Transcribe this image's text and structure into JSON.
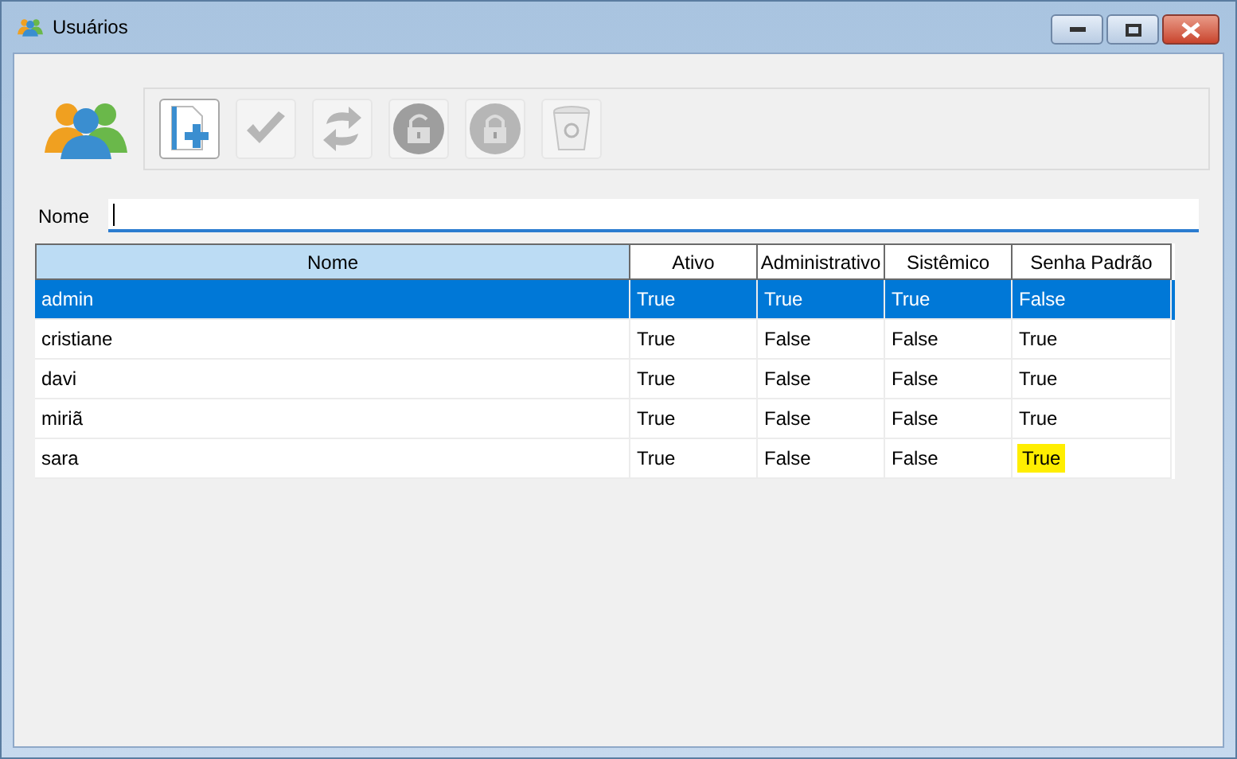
{
  "window": {
    "title": "Usuários"
  },
  "toolbar": [
    {
      "kind": "new",
      "disabled": false
    },
    {
      "kind": "check",
      "disabled": true
    },
    {
      "kind": "refresh",
      "disabled": true
    },
    {
      "kind": "unlock",
      "disabled": true
    },
    {
      "kind": "lock",
      "disabled": true
    },
    {
      "kind": "trash",
      "disabled": true
    }
  ],
  "filter": {
    "label": "Nome"
  },
  "table": {
    "columns": [
      {
        "label": "Nome",
        "selected": true
      },
      {
        "label": "Ativo",
        "selected": false
      },
      {
        "label": "Administrativo",
        "selected": false
      },
      {
        "label": "Sistêmico",
        "selected": false
      },
      {
        "label": "Senha Padrão",
        "selected": false
      }
    ],
    "rows": [
      {
        "selected": true,
        "cells": [
          {
            "text": "admin",
            "highlighted": false
          },
          {
            "text": "True",
            "highlighted": false
          },
          {
            "text": "True",
            "highlighted": false
          },
          {
            "text": "True",
            "highlighted": false
          },
          {
            "text": "False",
            "highlighted": false
          }
        ]
      },
      {
        "selected": false,
        "cells": [
          {
            "text": "cristiane",
            "highlighted": false
          },
          {
            "text": "True",
            "highlighted": false
          },
          {
            "text": "False",
            "highlighted": false
          },
          {
            "text": "False",
            "highlighted": false
          },
          {
            "text": "True",
            "highlighted": false
          }
        ]
      },
      {
        "selected": false,
        "cells": [
          {
            "text": "davi",
            "highlighted": false
          },
          {
            "text": "True",
            "highlighted": false
          },
          {
            "text": "False",
            "highlighted": false
          },
          {
            "text": "False",
            "highlighted": false
          },
          {
            "text": "True",
            "highlighted": false
          }
        ]
      },
      {
        "selected": false,
        "cells": [
          {
            "text": "miriã",
            "highlighted": false
          },
          {
            "text": "True",
            "highlighted": false
          },
          {
            "text": "False",
            "highlighted": false
          },
          {
            "text": "False",
            "highlighted": false
          },
          {
            "text": "True",
            "highlighted": false
          }
        ]
      },
      {
        "selected": false,
        "cells": [
          {
            "text": "sara",
            "highlighted": false
          },
          {
            "text": "True",
            "highlighted": false
          },
          {
            "text": "False",
            "highlighted": false
          },
          {
            "text": "False",
            "highlighted": false
          },
          {
            "text": "True",
            "highlighted": true
          }
        ]
      }
    ]
  }
}
